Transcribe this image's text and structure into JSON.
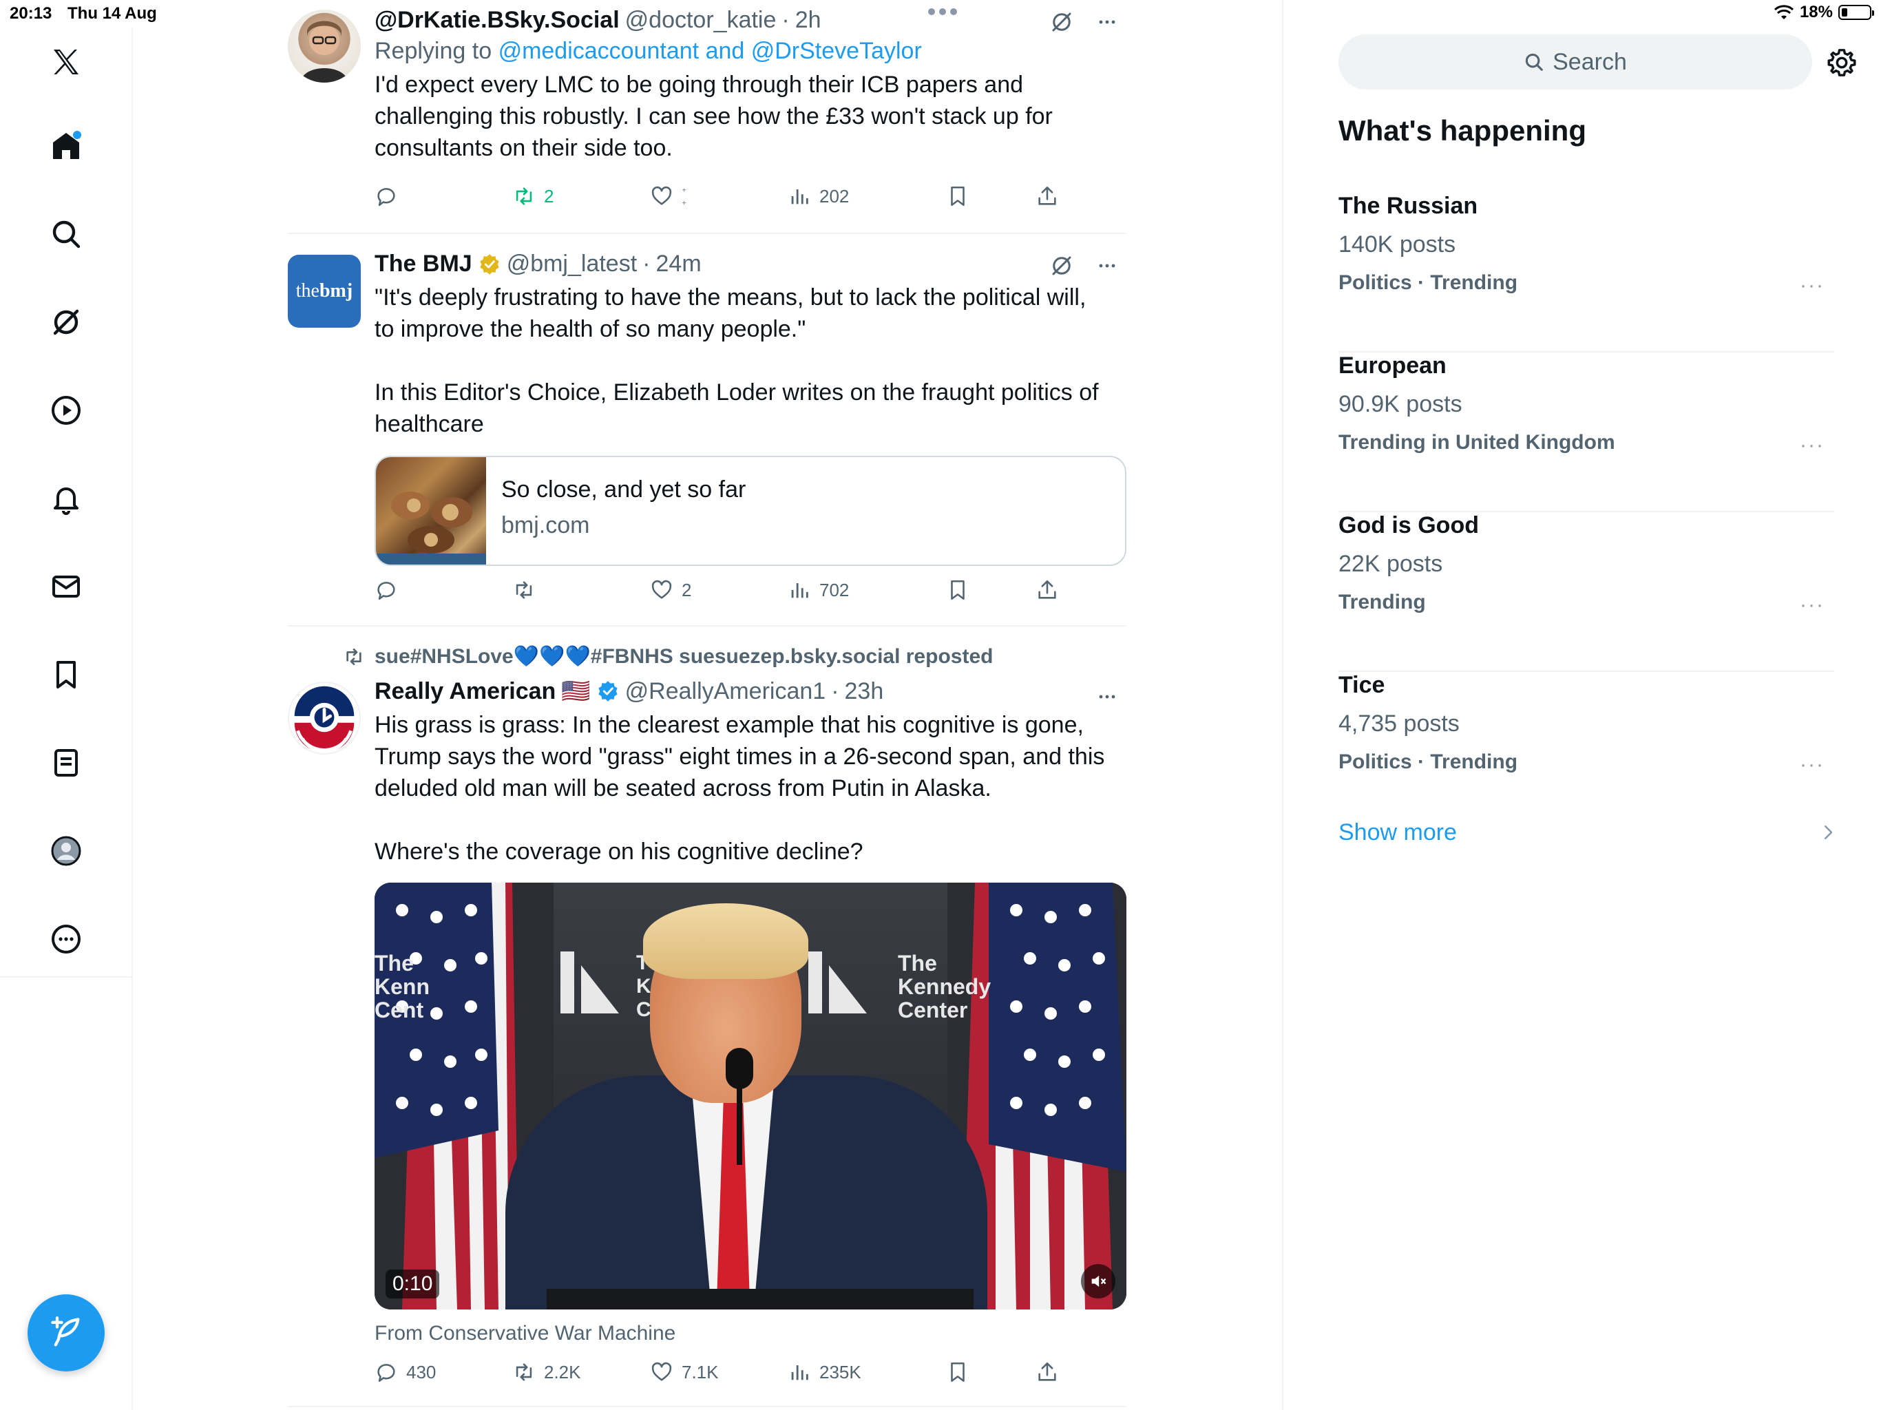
{
  "status_bar": {
    "time": "20:13",
    "date": "Thu 14 Aug",
    "battery": "18%",
    "battery_level": 0.18
  },
  "nav": {
    "items": [
      "x-logo",
      "home",
      "search",
      "grok",
      "video",
      "notifications",
      "messages",
      "bookmarks",
      "lists",
      "profile",
      "more"
    ]
  },
  "compose": {
    "icon": "compose-feather-icon"
  },
  "tweets": [
    {
      "name": "@DrKatie.BSky.Social",
      "handle": "@doctor_katie",
      "dot": "·",
      "time": "2h",
      "replying_prefix": "Replying to",
      "replying_to": "@medicaccountant and @DrSteveTaylor",
      "text": "I'd expect every LMC to be going through their ICB papers and challenging this robustly. I can see how the £33 won't stack up for consultants on their side too.",
      "reposts": "2",
      "views": "202"
    },
    {
      "name": "The BMJ",
      "handle": "@bmj_latest",
      "dot": "·",
      "time": "24m",
      "avatar_text_a": "the",
      "avatar_text_b": "bmj",
      "text_1": "\"It's deeply frustrating to have the means, but to lack the political will, to improve the health of so many people.\"",
      "text_2": "In this Editor's Choice, Elizabeth Loder writes on the fraught politics of healthcare",
      "card_title": "So close, and yet so far",
      "card_domain": "bmj.com",
      "likes": "2",
      "views": "702"
    },
    {
      "reposted_by": "sue#NHSLove💙💙💙#FBNHS suesuezep.bsky.social reposted",
      "name": "Really American",
      "flag": "🇺🇸",
      "handle": "@ReallyAmerican1",
      "dot": "·",
      "time": "23h",
      "text_1": "His grass is grass: In the clearest example that his cognitive is gone, Trump says the word \"grass\" eight times in a 26-second span, and this deluded old man will be seated across from Putin in Alaska.",
      "text_2": "Where's the coverage on his cognitive decline?",
      "video_time": "0:10",
      "video_backdrop_a": "The\nKenn\nCent",
      "video_backdrop_b": "T\nK\nC",
      "video_backdrop_c": "The\nKennedy\nCenter",
      "from": "From Conservative War Machine",
      "replies": "430",
      "reposts": "2.2K",
      "likes": "7.1K",
      "views": "235K"
    }
  ],
  "sidebar": {
    "search_placeholder": "Search",
    "heading": "What's happening",
    "trends": [
      {
        "title": "The Russian",
        "posts": "140K posts",
        "category": "Politics · Trending"
      },
      {
        "title": "European",
        "posts": "90.9K posts",
        "category": "Trending in United Kingdom"
      },
      {
        "title": "God is Good",
        "posts": "22K posts",
        "category": "Trending"
      },
      {
        "title": "Tice",
        "posts": "4,735 posts",
        "category": "Politics · Trending"
      }
    ],
    "more_dots": "···",
    "show_more": "Show more"
  },
  "colors": {
    "accent": "#1d9bf0",
    "repost_green": "#00ba7c",
    "muted": "#536471",
    "bmj_blue": "#2a6ebb"
  }
}
